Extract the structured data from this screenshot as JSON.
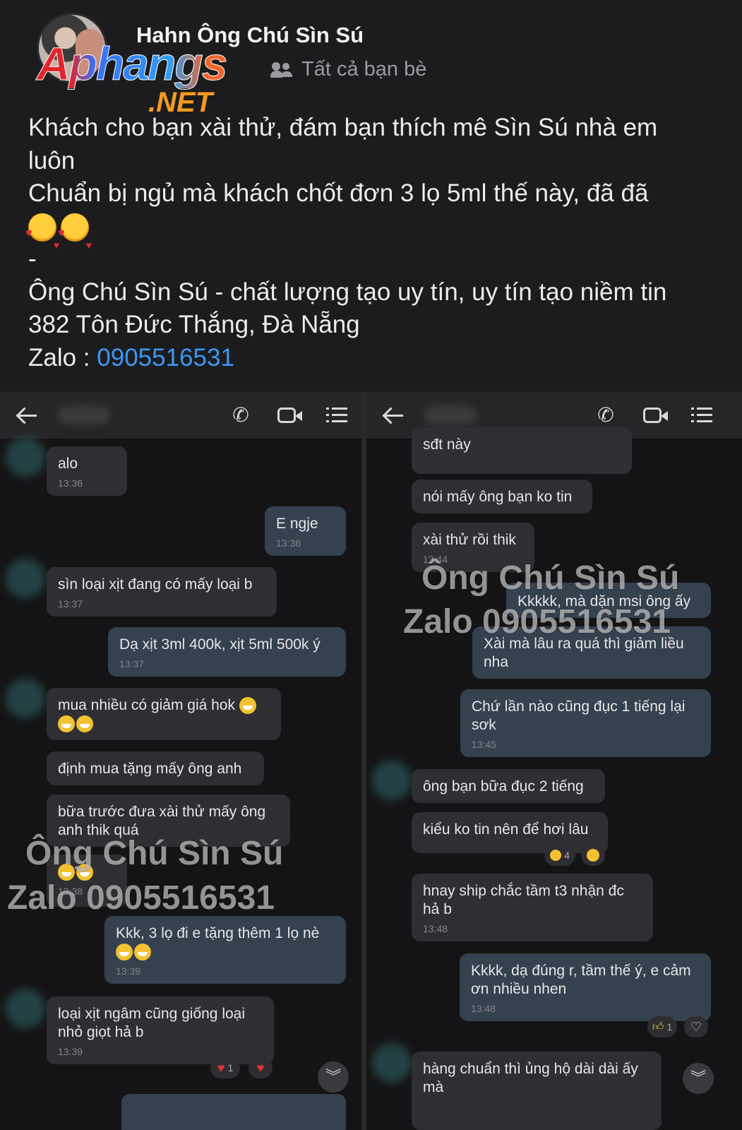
{
  "post": {
    "poster_name": "Hahn Ông Chú Sìn Sú",
    "audience": "Tất cả bạn bè",
    "logo_text": "Aphangs",
    "logo_suffix": ".NET",
    "lines": [
      "Khách cho bạn xài thử, đám bạn thích mê Sìn Sú nhà em",
      "luôn",
      "Chuẩn bị ngủ mà khách chốt đơn 3 lọ 5ml thế này, đã đã",
      "-",
      "Ông Chú Sìn Sú - chất lượng tạo uy tín, uy tín tạo niềm tin",
      "382 Tôn Đức Thắng, Đà Nẵng"
    ],
    "zalo_label": "Zalo : ",
    "zalo_phone": "0905516531"
  },
  "watermark": {
    "line1": "Ông Chú Sìn Sú",
    "line2": "Zalo 0905516531"
  },
  "left_chat": {
    "messages": [
      {
        "text": "alo",
        "time": "13:36"
      },
      {
        "text": "E ngje",
        "time": "13:36"
      },
      {
        "text": "sìn loại xịt đang có mấy loại b",
        "time": "13:37"
      },
      {
        "text": "Dạ xịt 3ml 400k, xịt 5ml 500k ý",
        "time": "13:37"
      },
      {
        "text": "mua nhiều có giảm giá hok",
        "time": ""
      },
      {
        "text": "định mua tặng mấy ông anh",
        "time": ""
      },
      {
        "text": "bữa trước đưa xài thử mấy ông anh thik quá",
        "time": ""
      },
      {
        "text": "",
        "time": "13:38"
      },
      {
        "text": "Kkk, 3 lọ đi e tặng thêm 1 lọ nè",
        "time": "13:39"
      },
      {
        "text": "loại xịt ngâm cũng giống loại nhỏ giọt hả b",
        "time": "13:39"
      }
    ],
    "reaction_count": "1"
  },
  "right_chat": {
    "messages": [
      {
        "text": "sđt này",
        "time": ""
      },
      {
        "text": "nói mấy ông bạn ko tin",
        "time": ""
      },
      {
        "text": "xài thử rồi thik",
        "time": "13:44"
      },
      {
        "text": "Kkkkk, mà dặn msi ông ấy",
        "time": ""
      },
      {
        "text": "Xài mà lâu ra quá thì giảm liều nha",
        "time": ""
      },
      {
        "text": "Chứ lần nào cũng đục 1 tiếng lại sơk",
        "time": "13:45"
      },
      {
        "text": "ông bạn bữa đục 2 tiếng",
        "time": ""
      },
      {
        "text": "kiểu ko tin nên để hơi lâu",
        "time": ""
      },
      {
        "text": "hnay ship chắc tầm t3 nhận đc hả b",
        "time": "13:48"
      },
      {
        "text": "Kkkk, dạ đúng r, tầm thế ý, e cảm ơn nhiều nhen",
        "time": "13:48"
      },
      {
        "text": "hàng chuẩn thì ủng hộ dài dài ấy mà",
        "time": ""
      }
    ],
    "reaction_count_a": "4",
    "reaction_count_b": "1"
  },
  "icons": [
    "back-arrow-icon",
    "phone-icon",
    "video-call-icon",
    "menu-list-icon",
    "friends-icon",
    "heart-icon",
    "chevron-down-icon"
  ]
}
